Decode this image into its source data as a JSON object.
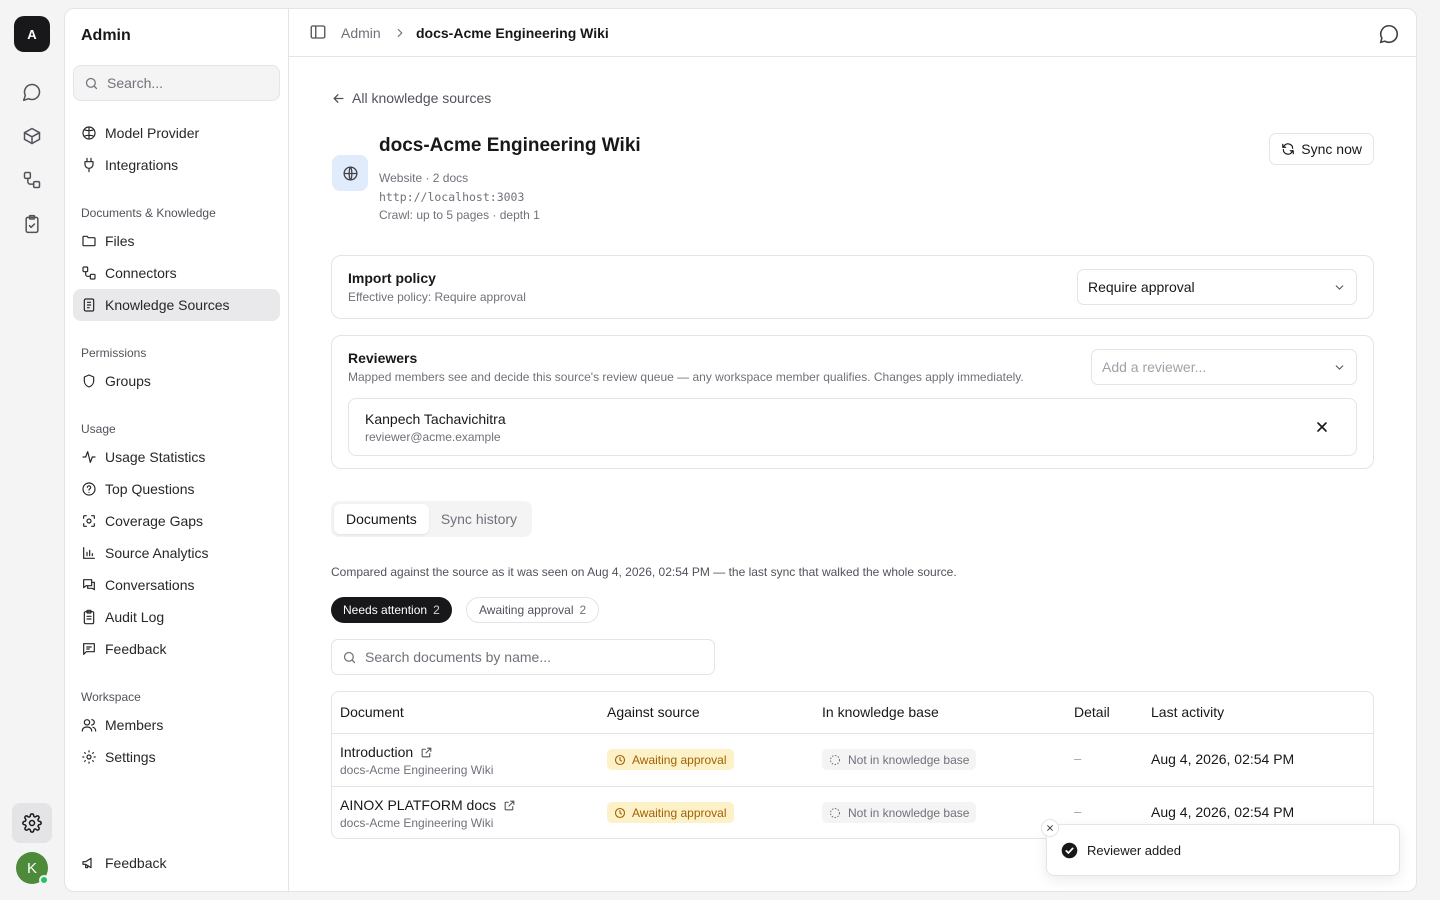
{
  "rail": {
    "logo_letter": "A",
    "avatar_letter": "K"
  },
  "sidebar": {
    "title": "Admin",
    "search_placeholder": "Search...",
    "top_items": [
      "Model Provider",
      "Integrations"
    ],
    "groups": [
      {
        "label": "Documents & Knowledge",
        "items": [
          "Files",
          "Connectors",
          "Knowledge Sources"
        ]
      },
      {
        "label": "Permissions",
        "items": [
          "Groups"
        ]
      },
      {
        "label": "Usage",
        "items": [
          "Usage Statistics",
          "Top Questions",
          "Coverage Gaps",
          "Source Analytics",
          "Conversations",
          "Audit Log",
          "Feedback"
        ]
      },
      {
        "label": "Workspace",
        "items": [
          "Members",
          "Settings"
        ]
      }
    ],
    "footer_item": "Feedback"
  },
  "breadcrumb": {
    "root": "Admin",
    "current": "docs-Acme Engineering Wiki"
  },
  "page": {
    "back_label": "All knowledge sources",
    "title": "docs-Acme Engineering Wiki",
    "meta_type": "Website · 2 docs",
    "url": "http://localhost:3003",
    "crawl": "Crawl: up to 5 pages · depth 1",
    "sync_label": "Sync now"
  },
  "import_policy": {
    "title": "Import policy",
    "subtitle": "Effective policy: Require approval",
    "selected": "Require approval"
  },
  "reviewers": {
    "title": "Reviewers",
    "subtitle": "Mapped members see and decide this source's review queue — any workspace member qualifies. Changes apply immediately.",
    "add_placeholder": "Add a reviewer...",
    "list": [
      {
        "name": "Kanpech Tachavichitra",
        "email": "reviewer@acme.example"
      }
    ]
  },
  "tabs": [
    "Documents",
    "Sync history"
  ],
  "compare_note": "Compared against the source as it was seen on Aug 4, 2026, 02:54 PM — the last sync that walked the whole source.",
  "filters": [
    {
      "label": "Needs attention",
      "count": "2"
    },
    {
      "label": "Awaiting approval",
      "count": "2"
    }
  ],
  "doc_search_placeholder": "Search documents by name...",
  "table": {
    "headers": [
      "Document",
      "Against source",
      "In knowledge base",
      "Detail",
      "Last activity"
    ],
    "rows": [
      {
        "name": "Introduction",
        "source": "docs-Acme Engineering Wiki",
        "against": "Awaiting approval",
        "kb": "Not in knowledge base",
        "detail": "–",
        "activity": "Aug 4, 2026, 02:54 PM"
      },
      {
        "name": "AINOX PLATFORM docs",
        "source": "docs-Acme Engineering Wiki",
        "against": "Awaiting approval",
        "kb": "Not in knowledge base",
        "detail": "–",
        "activity": "Aug 4, 2026, 02:54 PM"
      }
    ]
  },
  "toast": {
    "message": "Reviewer added"
  }
}
